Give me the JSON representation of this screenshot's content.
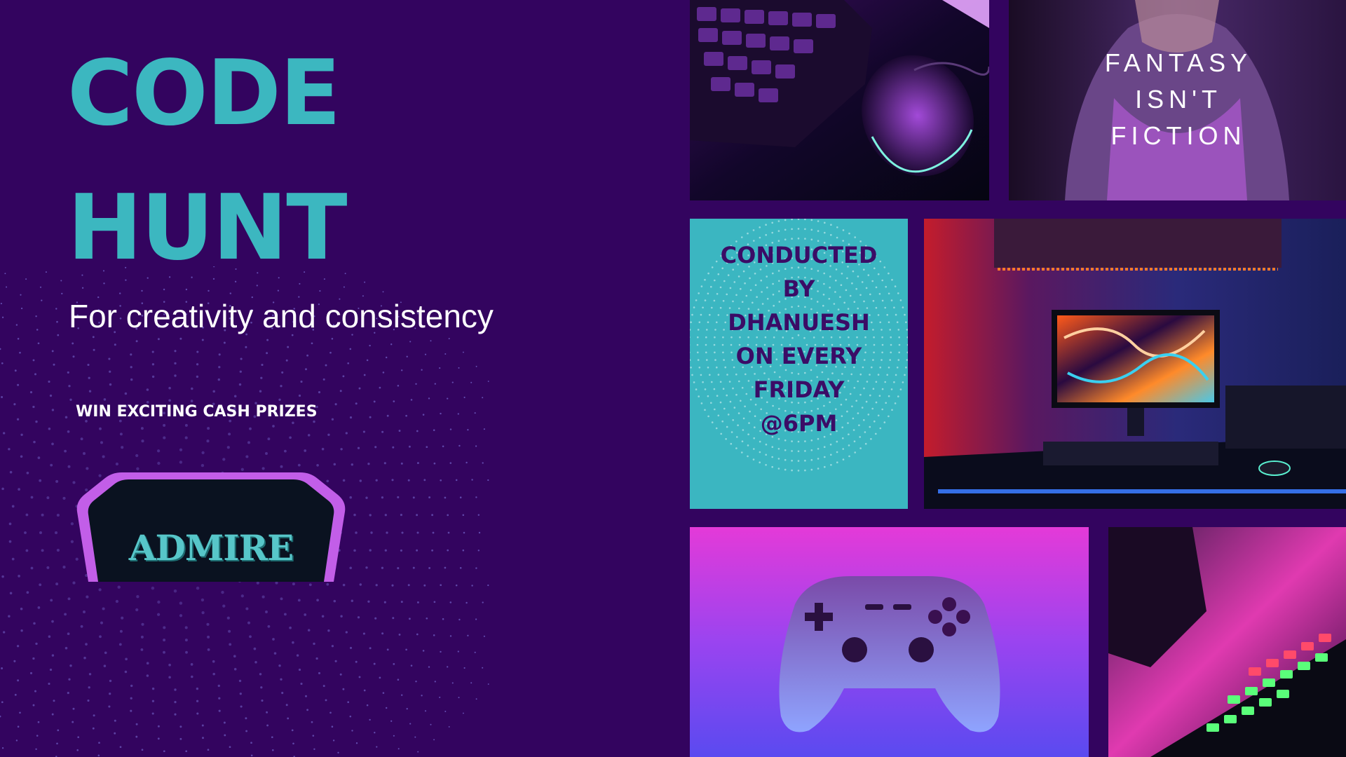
{
  "title_line_1": "CODE",
  "title_line_2": "HUNT",
  "subtitle": "For creativity and consistency",
  "prize_text": "WIN EXCITING CASH PRIZES",
  "badge_text": "ADMIRE",
  "quote": "FANTASY\nISN'T\nFICTION",
  "info_card_text": "CONDUCTED\nBY\nDHANUESH\nON EVERY\nFRIDAY\n@6PM",
  "colors": {
    "background": "#33045f",
    "accent_teal": "#3bb6c1",
    "accent_purple": "#c25ee8",
    "card_text": "#3b0c66"
  }
}
